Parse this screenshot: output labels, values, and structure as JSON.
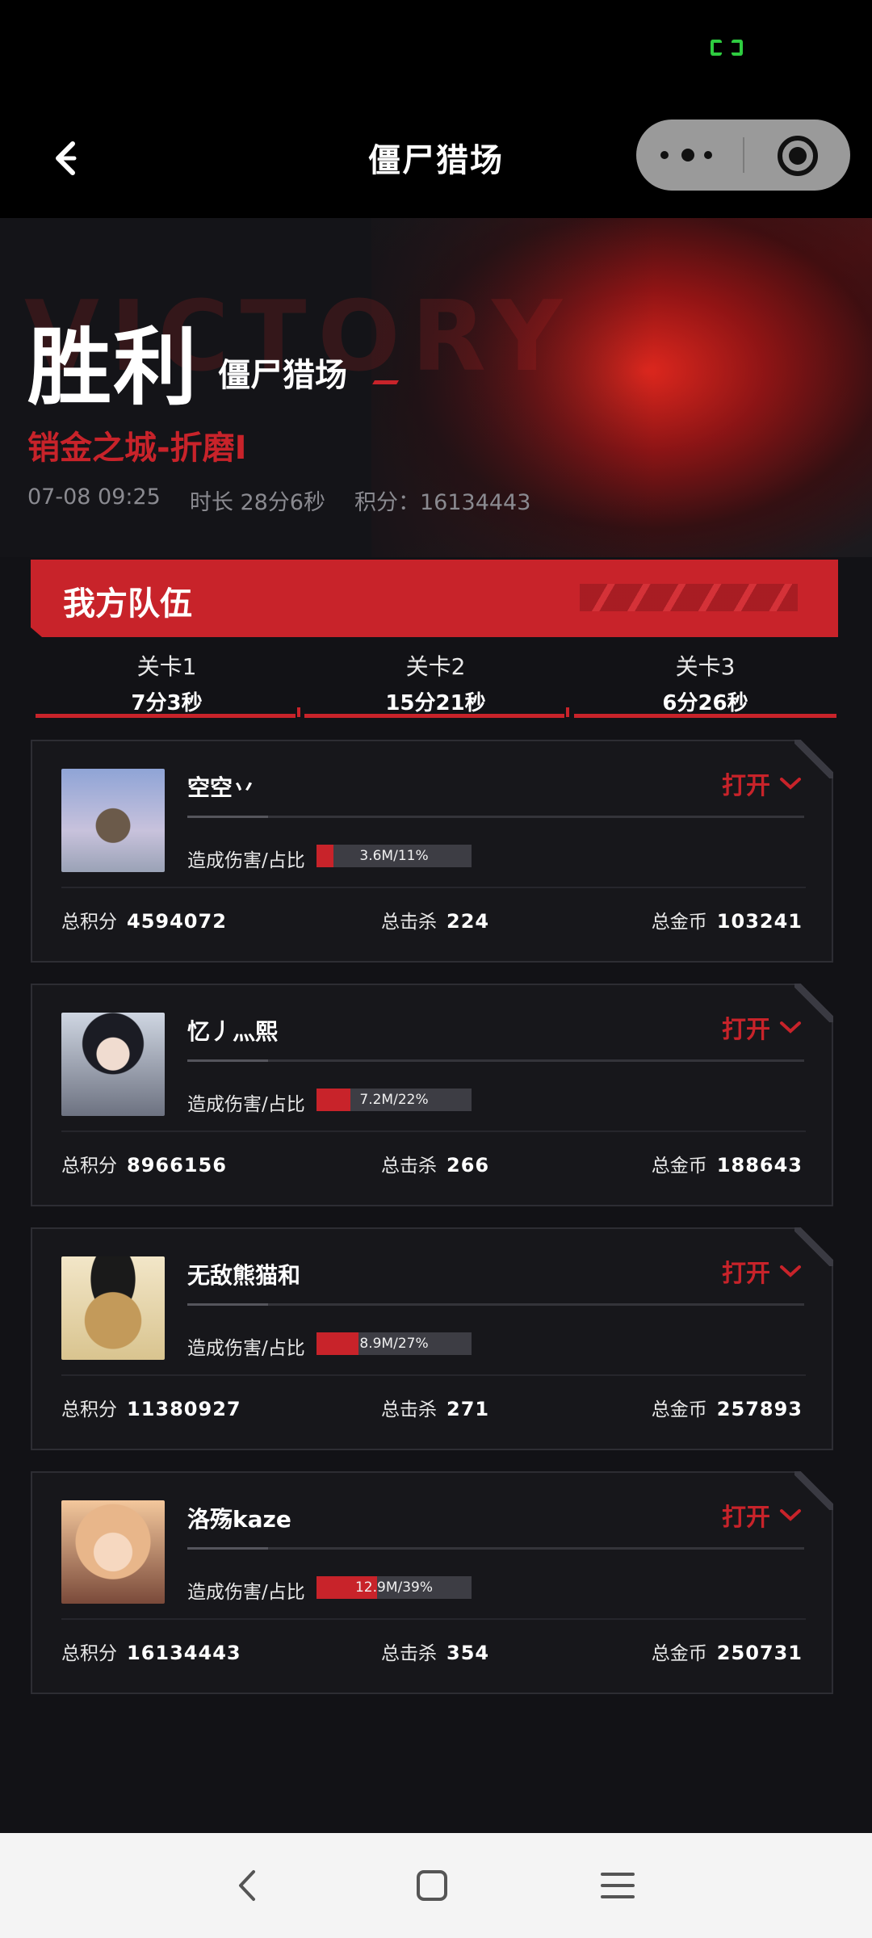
{
  "nav": {
    "title": "僵尸猎场"
  },
  "hero": {
    "watermark": "VICTORY",
    "result": "胜利",
    "mode": "僵尸猎场",
    "level": "销金之城-折磨I",
    "datetime": "07-08 09:25",
    "duration": "时长 28分6秒",
    "score": "积分：16134443"
  },
  "team": {
    "title": "我方队伍"
  },
  "stages": [
    {
      "name": "关卡1",
      "time": "7分3秒"
    },
    {
      "name": "关卡2",
      "time": "15分21秒"
    },
    {
      "name": "关卡3",
      "time": "6分26秒"
    }
  ],
  "labels": {
    "open": "打开",
    "damage": "造成伤害/占比",
    "total_score": "总积分",
    "total_kills": "总击杀",
    "total_gold": "总金币"
  },
  "players": [
    {
      "name": "空空丷",
      "damage": "3.6M/11%",
      "damage_share": 0.11,
      "score": "4594072",
      "kills": "224",
      "gold": "103241"
    },
    {
      "name": "忆丿灬熙",
      "damage": "7.2M/22%",
      "damage_share": 0.22,
      "score": "8966156",
      "kills": "266",
      "gold": "188643"
    },
    {
      "name": "无敌熊猫和",
      "damage": "8.9M/27%",
      "damage_share": 0.27,
      "score": "11380927",
      "kills": "271",
      "gold": "257893"
    },
    {
      "name": "洛殇kaze",
      "damage": "12.9M/39%",
      "damage_share": 0.39,
      "score": "16134443",
      "kills": "354",
      "gold": "250731"
    }
  ],
  "colors": {
    "accent": "#c8232a",
    "background": "#121216",
    "card_border": "#2d2d33"
  }
}
